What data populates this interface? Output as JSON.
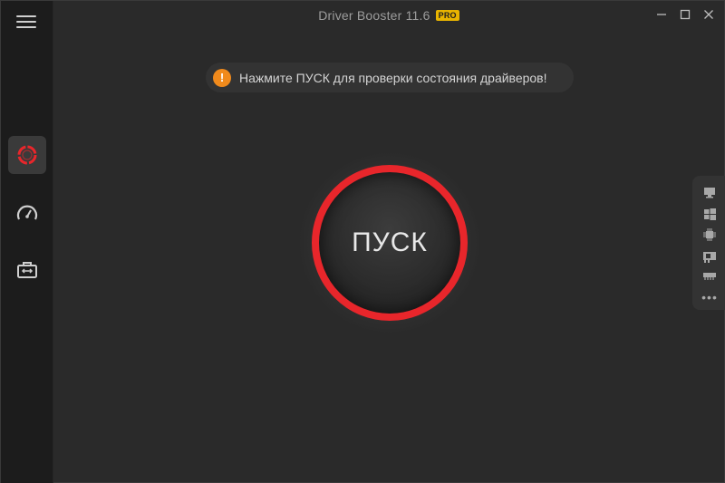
{
  "app": {
    "title": "Driver Booster 11.6",
    "pro_badge": "PRO"
  },
  "sidebar": {
    "menu_icon": "hamburger-icon",
    "items": [
      {
        "id": "scan",
        "icon": "scan-ring-icon",
        "active": true
      },
      {
        "id": "boost",
        "icon": "speedometer-icon",
        "active": false
      },
      {
        "id": "tools",
        "icon": "toolbox-icon",
        "active": false
      }
    ]
  },
  "notice": {
    "icon": "!",
    "text": "Нажмите ПУСК для проверки состояния драйверов!"
  },
  "start_button": {
    "label": "ПУСК"
  },
  "right_panel": {
    "items": [
      "monitor-icon",
      "windows-icon",
      "chip-icon",
      "network-card-icon",
      "memory-icon",
      "more-icon"
    ]
  },
  "colors": {
    "accent_red": "#e8262b",
    "notice_orange": "#f08a1c",
    "pro_yellow": "#e8b400",
    "background": "#2a2a2a"
  }
}
